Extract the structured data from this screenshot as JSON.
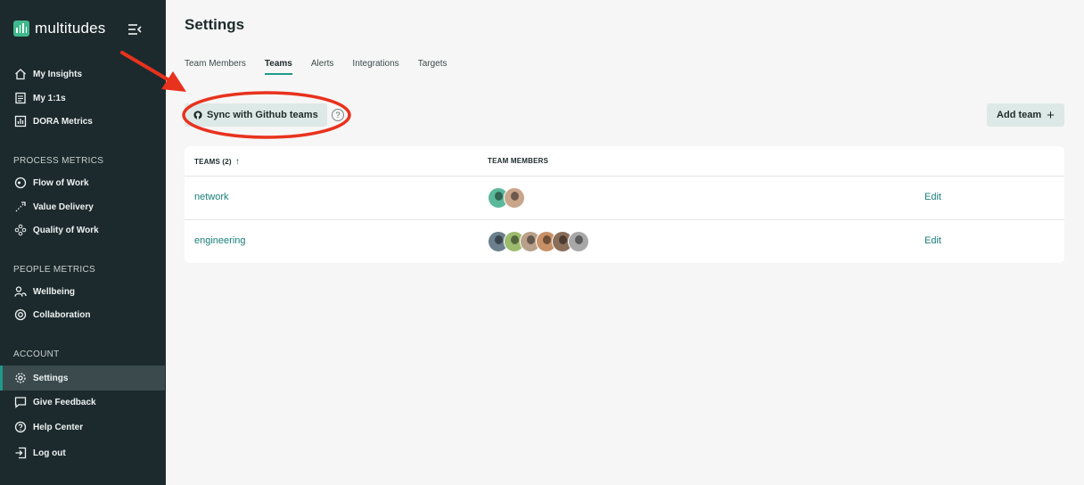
{
  "brand": {
    "name": "multitudes"
  },
  "sidebar": {
    "top_items": [
      {
        "label": "My Insights",
        "icon": "home-icon"
      },
      {
        "label": "My 1:1s",
        "icon": "notes-icon"
      },
      {
        "label": "DORA Metrics",
        "icon": "bar-chart-icon"
      }
    ],
    "process_title": "PROCESS METRICS",
    "process_items": [
      {
        "label": "Flow of Work",
        "icon": "flow-icon"
      },
      {
        "label": "Value Delivery",
        "icon": "value-icon"
      },
      {
        "label": "Quality of Work",
        "icon": "quality-icon"
      }
    ],
    "people_title": "PEOPLE METRICS",
    "people_items": [
      {
        "label": "Wellbeing",
        "icon": "wellbeing-icon"
      },
      {
        "label": "Collaboration",
        "icon": "collaboration-icon"
      }
    ],
    "account_title": "ACCOUNT",
    "account_items": [
      {
        "label": "Settings",
        "icon": "gear-icon",
        "active": true
      },
      {
        "label": "Give Feedback",
        "icon": "chat-icon"
      },
      {
        "label": "Help Center",
        "icon": "help-icon"
      },
      {
        "label": "Log out",
        "icon": "logout-icon"
      }
    ]
  },
  "page": {
    "title": "Settings",
    "tabs": [
      {
        "label": "Team Members",
        "active": false
      },
      {
        "label": "Teams",
        "active": true
      },
      {
        "label": "Alerts",
        "active": false
      },
      {
        "label": "Integrations",
        "active": false
      },
      {
        "label": "Targets",
        "active": false
      }
    ],
    "sync_button": "Sync with Github teams",
    "help_glyph": "?",
    "add_team_button": "Add team",
    "add_team_glyph": "+"
  },
  "table": {
    "col_teams": "TEAMS (2)",
    "sort_glyph": "↑",
    "col_members": "TEAM MEMBERS",
    "rows": [
      {
        "name": "network",
        "action": "Edit",
        "avatar_colors": [
          "#5bb89a",
          "#c9a58a"
        ]
      },
      {
        "name": "engineering",
        "action": "Edit",
        "avatar_colors": [
          "#6b7f8c",
          "#9cbb6e",
          "#b8a08a",
          "#c89066",
          "#8a6e5a",
          "#a8a8a8"
        ]
      }
    ]
  },
  "colors": {
    "sidebar_bg": "#1d2a2d",
    "accent": "#1f9a8a",
    "link": "#187f7a",
    "annotation": "#e8321e"
  }
}
